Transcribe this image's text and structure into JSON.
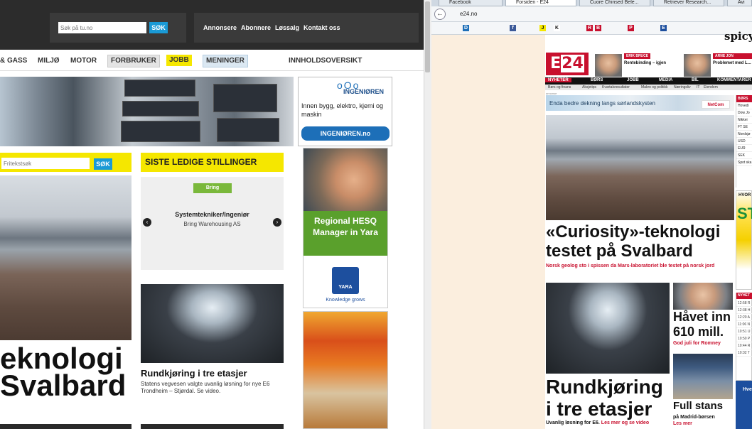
{
  "left": {
    "header": {
      "search_placeholder": "Søk på tu.no",
      "search_button": "SØK",
      "links": [
        "Annonsere",
        "Abonnere",
        "Løssalg",
        "Kontakt oss"
      ]
    },
    "nav": {
      "items": [
        "& GASS",
        "MILJØ",
        "MOTOR",
        "FORBRUKER",
        "JOBB",
        "MENINGER",
        "INNHOLDSOVERSIKT"
      ]
    },
    "ad_ingenioren": {
      "logo": "oOo",
      "name": "INGENIØREN",
      "text": "Innen bygg, elektro, kjemi og maskin",
      "button": "INGENIØREN.no"
    },
    "search2": {
      "placeholder": "Fritekstsøk",
      "button": "SØK"
    },
    "main_headline": "eknologi\nSvalbard",
    "jobs": {
      "header": "SISTE LEDIGE STILLINGER",
      "logo": "Bring",
      "title": "Systemtekniker/Ingeniør",
      "company": "Bring Warehousing AS",
      "prev": "‹",
      "next": "›"
    },
    "article": {
      "title": "Rundkjøring i tre etasjer",
      "desc": "Statens vegvesen valgte uvanlig løsning for nye E6 Trondheim – Stjørdal. Se video."
    },
    "ad_yara": {
      "green_text": "Regional HESQ Manager in Yara",
      "logo": "YARA",
      "tag": "Knowledge grows"
    }
  },
  "right": {
    "tabs": [
      "Facebook",
      "Forsiden - E24",
      "Cuore Chinsed Bele...",
      "Retriever Research...",
      "Avi"
    ],
    "url": "e24.no",
    "back": "←",
    "bookmark_glyphs": [
      "D",
      "f",
      "J",
      "K",
      "B",
      "R",
      "P",
      "E"
    ],
    "spicy": "spicy",
    "logo": "24",
    "bylines": [
      {
        "tag": "ERIK BRUCE",
        "text": "Rentebinding – igjen"
      },
      {
        "tag": "ARNE JON ISACHSEN",
        "text": "Problemet med L..."
      }
    ],
    "nav": [
      "NYHETER",
      "BØRS",
      "JOBB",
      "MEDIA",
      "BIL",
      "KOMMENTARER"
    ],
    "subnav": [
      "Børs og finans",
      "Aksjetips",
      "Kvartalsresultater",
      "Makro og politikk",
      "Næringsliv",
      "IT",
      "Eiendom"
    ],
    "annonse": "annonse",
    "ad": {
      "text": "Enda bedre dekning langs sørlandskysten",
      "logo": "NetCom"
    },
    "main": {
      "headline": "«Curiosity»-teknologi testet på Svalbard",
      "sub": "Norsk geolog sto i spissen da Mars-laboratoriet ble testet på norsk jord"
    },
    "second": {
      "headline": "Rundkjøring i tre etasjer",
      "sub_prefix": "Uvanlig løsning for E6.",
      "sub_link": "Les mer og se video"
    },
    "third": {
      "headline": "Håvet inn 610 mill.",
      "sub": "God juli for Romney"
    },
    "fourth": {
      "headline": "Full stans",
      "sub": "på Madrid-børsen",
      "link": "Les mer"
    },
    "market": {
      "header": "BØRS",
      "rows": [
        "Hovedi",
        "Dow Jo",
        "Nikkei",
        "FT SE",
        "Nordsjø",
        "USD",
        "EUR",
        "SEK",
        "Spot ska"
      ]
    },
    "side_ad": {
      "top": "HVOR",
      "big": "ST"
    },
    "news": {
      "header": "NYHET",
      "rows": [
        "12:58 R",
        "12:38 H",
        "12:20 A",
        "11:06 N",
        "10:51 U",
        "10:50 P",
        "10:44 R",
        "10:32 T"
      ]
    },
    "blue_box": "Hve"
  }
}
